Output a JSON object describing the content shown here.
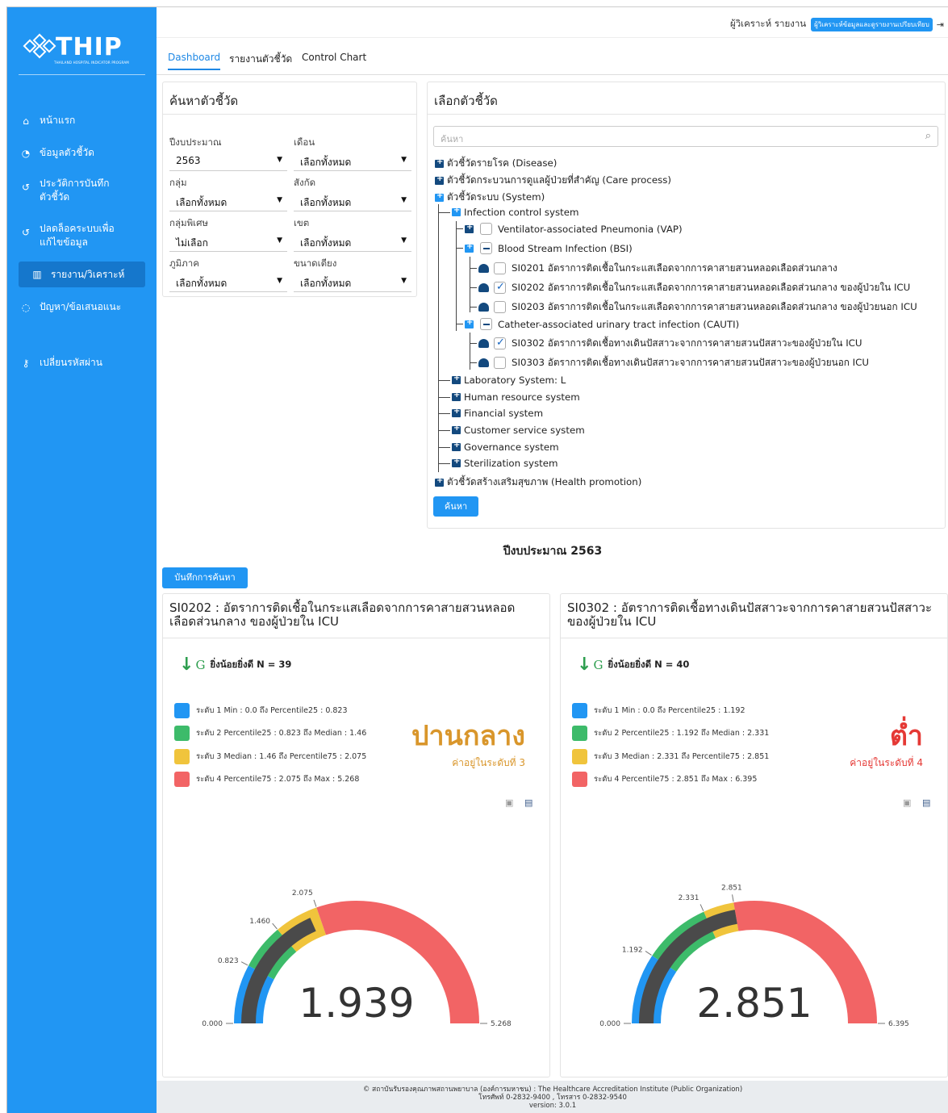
{
  "sidebar": {
    "logo_text": "THIP",
    "logo_sub": "THAILAND HOSPITAL INDICATOR PROGRAM",
    "items": [
      {
        "label": "หน้าแรก",
        "icon": "home-icon"
      },
      {
        "label": "ข้อมูลตัวชี้วัด",
        "icon": "dashboard-icon"
      },
      {
        "label": "ประวัติการบันทึก",
        "label2": "ตัวชี้วัด",
        "icon": "history-icon"
      },
      {
        "label": "ปลดล็อคระบบเพื่อ",
        "label2": "แก้ไขข้อมูล",
        "icon": "history-icon"
      },
      {
        "label": "รายงาน/วิเคราะห์",
        "icon": "chart-icon"
      },
      {
        "label": "ปัญหา/ข้อเสนอแนะ",
        "icon": "comment-icon"
      },
      {
        "label": "เปลี่ยนรหัสผ่าน",
        "icon": "key-icon"
      }
    ]
  },
  "topbar": {
    "user_text": "ผู้วิเคราะห์ รายงาน",
    "role_badge": "ผู้วิเคราะห์ข้อมูลและดูรายงานเปรียบเทียบ"
  },
  "tabs": [
    "Dashboard",
    "รายงานตัวชี้วัด",
    "Control Chart"
  ],
  "search_panel": {
    "title": "ค้นหาตัวชี้วัด",
    "fields": [
      {
        "label": "ปีงบประมาณ",
        "value": "2563"
      },
      {
        "label": "เดือน",
        "value": "เลือกทั้งหมด"
      },
      {
        "label": "กลุ่ม",
        "value": "เลือกทั้งหมด"
      },
      {
        "label": "สังกัด",
        "value": "เลือกทั้งหมด"
      },
      {
        "label": "กลุ่มพิเศษ",
        "value": "ไม่เลือก"
      },
      {
        "label": "เขต",
        "value": "เลือกทั้งหมด"
      },
      {
        "label": "ภูมิภาค",
        "value": "เลือกทั้งหมด"
      },
      {
        "label": "ขนาดเตียง",
        "value": "เลือกทั้งหมด"
      }
    ]
  },
  "indicator_panel": {
    "title": "เลือกตัวชี้วัด",
    "search_placeholder": "ค้นหา",
    "tree": [
      "ตัวชี้วัดรายโรค (Disease)",
      "ตัวชี้วัดกระบวนการดูแลผู้ป่วยที่สำคัญ (Care process)",
      "ตัวชี้วัดระบบ (System)",
      "Infection control system",
      "Ventilator-associated Pneumonia (VAP)",
      "Blood Stream Infection (BSI)",
      "SI0201 อัตราการติดเชื้อในกระแสเลือดจากการคาสายสวนหลอดเลือดส่วนกลาง",
      "SI0202 อัตราการติดเชื้อในกระแสเลือดจากการคาสายสวนหลอดเลือดส่วนกลาง ของผู้ป่วยใน ICU",
      "SI0203 อัตราการติดเชื้อในกระแสเลือดจากการคาสายสวนหลอดเลือดส่วนกลาง ของผู้ป่วยนอก ICU",
      "Catheter-associated urinary tract infection (CAUTI)",
      "SI0302 อัตราการติดเชื้อทางเดินปัสสาวะจากการคาสายสวนปัสสาวะของผู้ป่วยใน ICU",
      "SI0303 อัตราการติดเชื้อทางเดินปัสสาวะจากการคาสายสวนปัสสาวะของผู้ป่วยนอก ICU",
      "Laboratory System: L",
      "Human resource system",
      "Financial system",
      "Customer service system",
      "Governance system",
      "Sterilization system",
      "ตัวชี้วัดสร้างเสริมสุขภาพ (Health promotion)"
    ],
    "search_button": "ค้นหา"
  },
  "year_heading": "ปีงบประมาณ 2563",
  "save_button": "บันทึกการค้นหา",
  "cards": [
    {
      "title": "SI0202 : อัตราการติดเชื้อในกระแสเลือดจากการคาสายสวนหลอดเลือดส่วนกลาง ของผู้ป่วยใน ICU",
      "trend_g": "G",
      "trend_text": "ยิ่งน้อยยิ่งดี N = 39",
      "legend": [
        "ระดับ 1 Min : 0.0 ถึง Percentile25 : 0.823",
        "ระดับ 2 Percentile25 : 0.823 ถึง Median : 1.46",
        "ระดับ 3 Median : 1.46 ถึง Percentile75 : 2.075",
        "ระดับ 4 Percentile75 : 2.075 ถึง Max : 5.268"
      ],
      "level_word": "ปานกลาง",
      "level_sub": "ค่าอยู่ในระดับที่ 3",
      "level_color": "#d9962b",
      "value_text": "1.939"
    },
    {
      "title": "SI0302 : อัตราการติดเชื้อทางเดินปัสสาวะจากการคาสายสวนปัสสาวะของผู้ป่วยใน ICU",
      "trend_g": "G",
      "trend_text": "ยิ่งน้อยยิ่งดี N = 40",
      "legend": [
        "ระดับ 1 Min : 0.0 ถึง Percentile25 : 1.192",
        "ระดับ 2 Percentile25 : 1.192 ถึง Median : 2.331",
        "ระดับ 3 Median : 2.331 ถึง Percentile75 : 2.851",
        "ระดับ 4 Percentile75 : 2.851 ถึง Max : 6.395"
      ],
      "level_word": "ต่ำ",
      "level_sub": "ค่าอยู่ในระดับที่ 4",
      "level_color": "#e53935",
      "value_text": "2.851"
    }
  ],
  "chart_data": [
    {
      "type": "gauge",
      "min": 0,
      "max": 5.268,
      "value": 1.939,
      "bands": [
        [
          0,
          0.823
        ],
        [
          0.823,
          1.46
        ],
        [
          1.46,
          2.075
        ],
        [
          2.075,
          5.268
        ]
      ],
      "band_colors": [
        "#2196f3",
        "#3dbb6a",
        "#f0c43c",
        "#f26465"
      ],
      "tick_labels": [
        "0.000",
        "0.823",
        "1.460",
        "2.075",
        "5.268"
      ],
      "tick_values": [
        0,
        0.823,
        1.46,
        2.075,
        5.268
      ]
    },
    {
      "type": "gauge",
      "min": 0,
      "max": 6.395,
      "value": 2.851,
      "bands": [
        [
          0,
          1.192
        ],
        [
          1.192,
          2.331
        ],
        [
          2.331,
          2.851
        ],
        [
          2.851,
          6.395
        ]
      ],
      "band_colors": [
        "#2196f3",
        "#3dbb6a",
        "#f0c43c",
        "#f26465"
      ],
      "tick_labels": [
        "0.000",
        "1.192",
        "2.331",
        "2.851",
        "6.395"
      ],
      "tick_values": [
        0,
        1.192,
        2.331,
        2.851,
        6.395
      ]
    }
  ],
  "footer": {
    "line1": "© สถาบันรับรองคุณภาพสถานพยาบาล (องค์การมหาชน) : The Healthcare Accreditation Institute (Public Organization)",
    "line2": "โทรศัพท์ 0-2832-9400 , โทรสาร 0-2832-9540",
    "line3": "version: 3.0.1"
  }
}
